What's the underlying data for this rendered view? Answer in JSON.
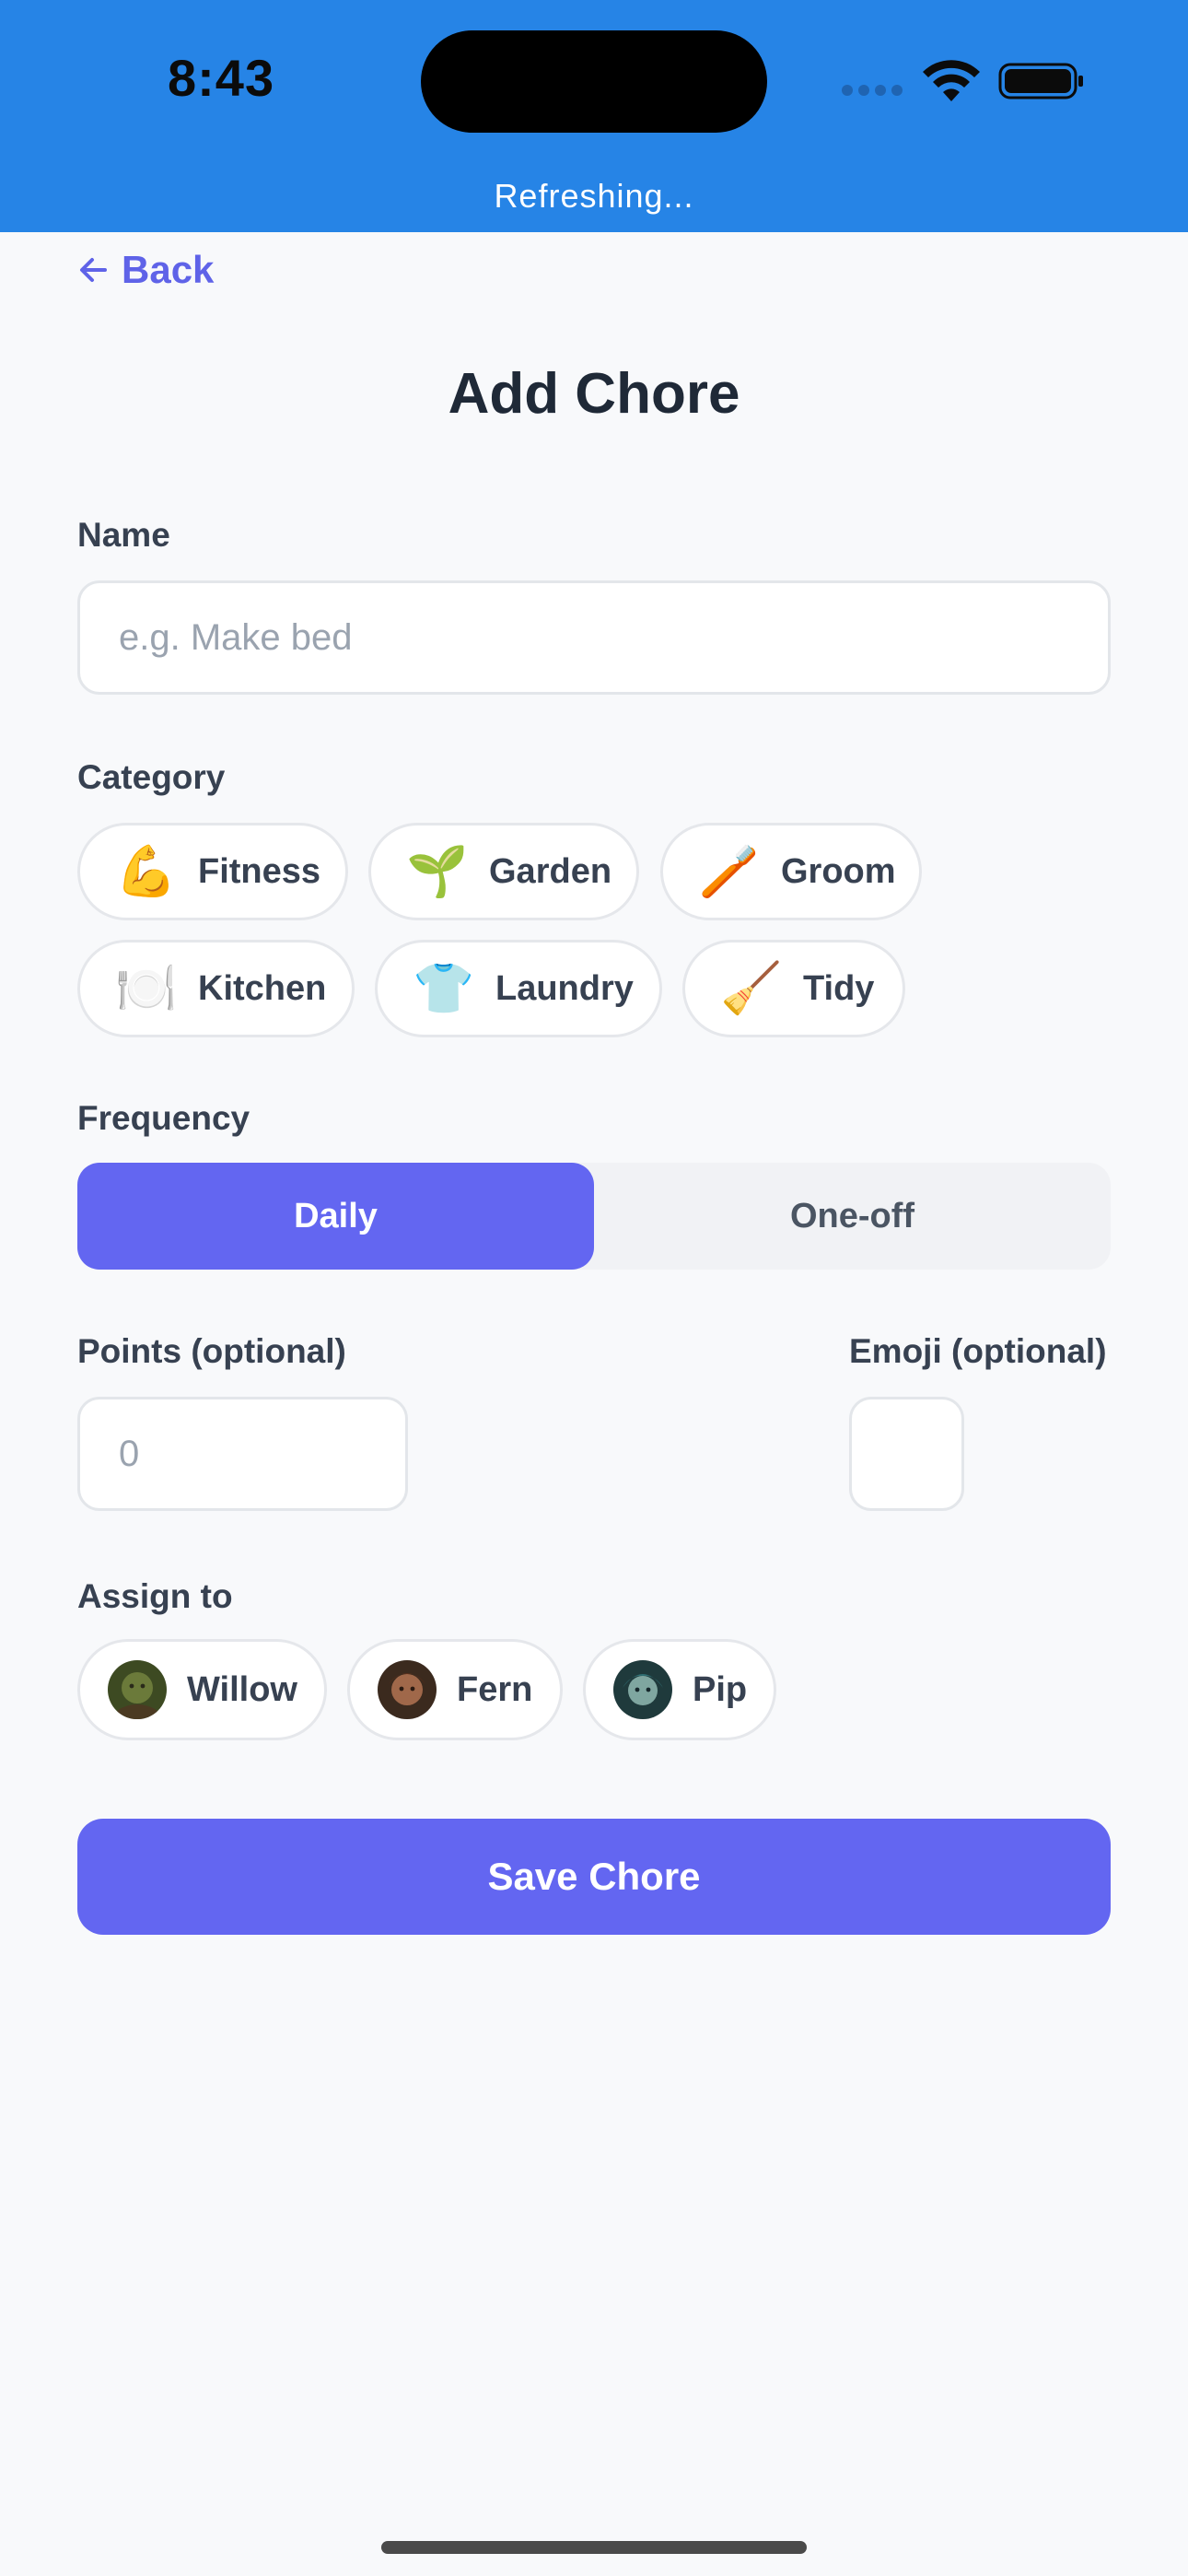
{
  "status_bar": {
    "time": "8:43",
    "refresh_text": "Refreshing...",
    "background": "#2684e6"
  },
  "nav": {
    "back_label": "Back",
    "back_icon": "arrow-left-icon"
  },
  "page": {
    "title": "Add Chore"
  },
  "form": {
    "name": {
      "label": "Name",
      "placeholder": "e.g. Make bed",
      "value": ""
    },
    "category": {
      "label": "Category",
      "options": [
        {
          "emoji": "💪",
          "label": "Fitness"
        },
        {
          "emoji": "🌱",
          "label": "Garden"
        },
        {
          "emoji": "🪥",
          "label": "Groom"
        },
        {
          "emoji": "🍽️",
          "label": "Kitchen"
        },
        {
          "emoji": "👕",
          "label": "Laundry"
        },
        {
          "emoji": "🧹",
          "label": "Tidy"
        }
      ]
    },
    "frequency": {
      "label": "Frequency",
      "options": [
        "Daily",
        "One-off"
      ],
      "selected": "Daily"
    },
    "points": {
      "label": "Points (optional)",
      "placeholder": "0",
      "value": ""
    },
    "emoji": {
      "label": "Emoji (optional)",
      "value": ""
    },
    "assign": {
      "label": "Assign to",
      "people": [
        {
          "name": "Willow",
          "avatar_color": "#6b7a3a"
        },
        {
          "name": "Fern",
          "avatar_color": "#7a4a2e"
        },
        {
          "name": "Pip",
          "avatar_color": "#2f6f73"
        }
      ]
    },
    "save_label": "Save Chore"
  },
  "colors": {
    "accent": "#6366f1",
    "background": "#f8f9fb",
    "text_primary": "#1f2937"
  }
}
